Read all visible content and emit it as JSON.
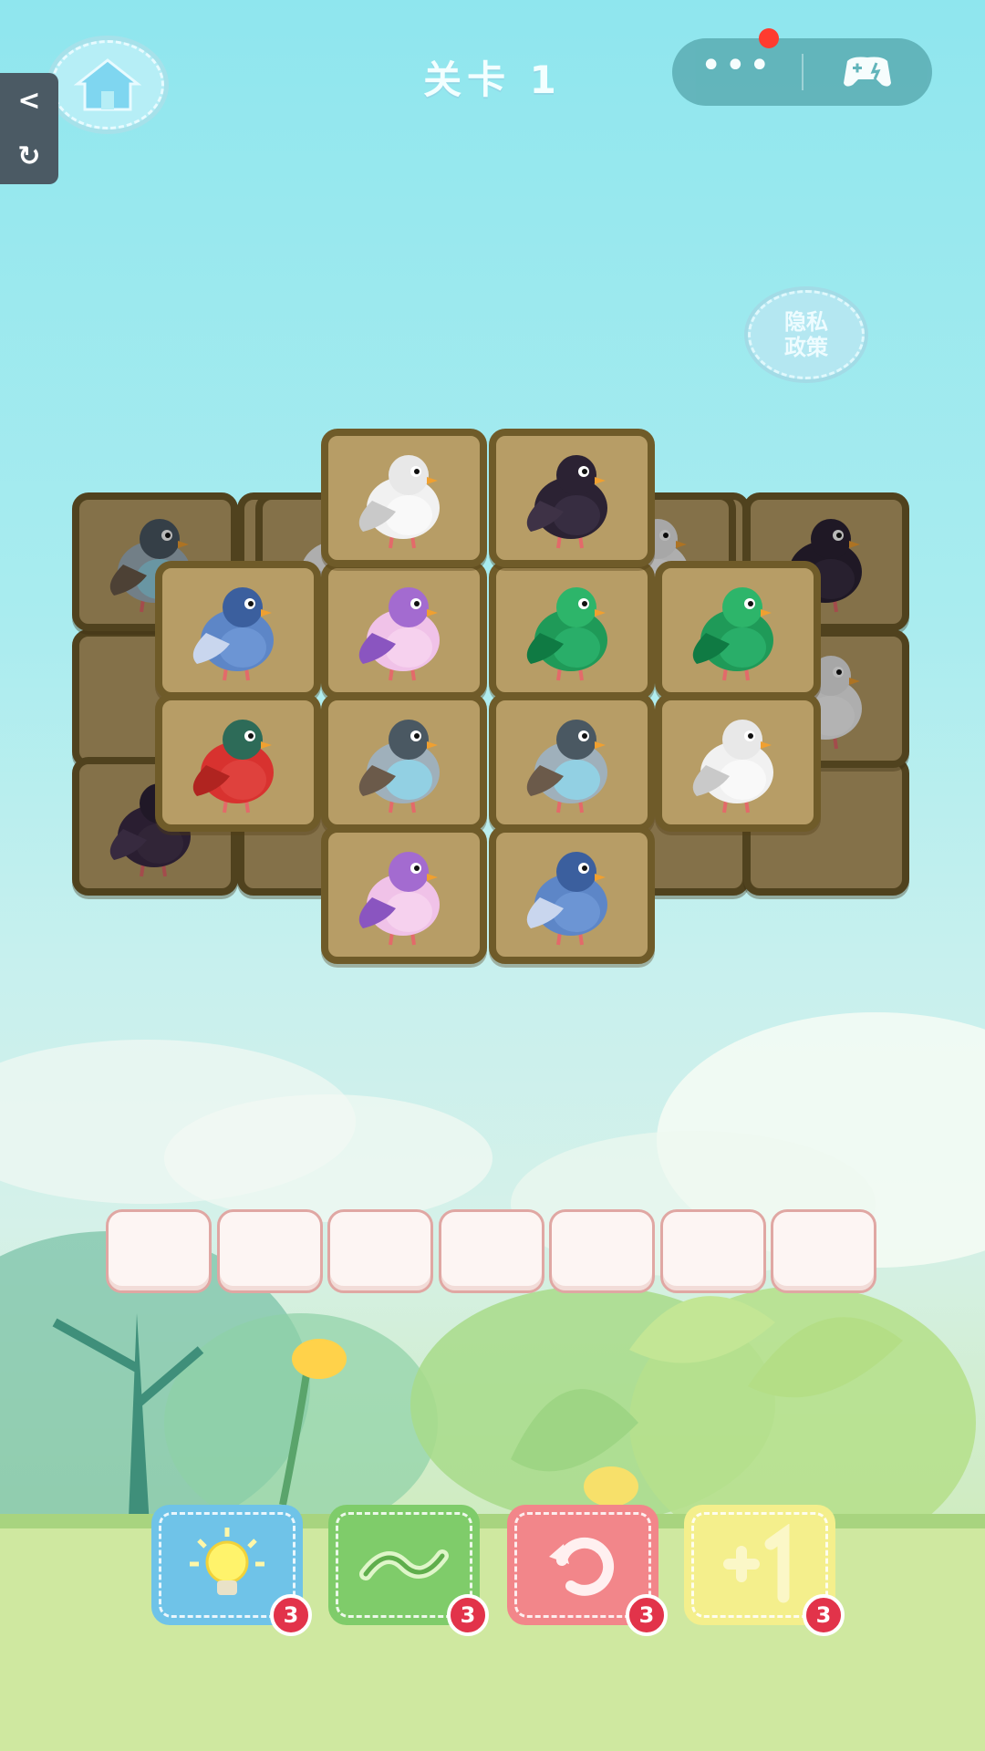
{
  "header": {
    "level_title": "关卡 1",
    "menu_dots": "•••",
    "privacy_label": "隐私\n政策",
    "back_symbol": "<",
    "refresh_symbol": "↻"
  },
  "board": {
    "tiles": [
      {
        "bird": "slate"
      },
      {
        "bird": "dark"
      },
      {
        "bird": "white"
      },
      {
        "bird": "white"
      },
      {
        "bird": "dark-purple"
      },
      {
        "bird": "white"
      },
      {
        "bird": "blue"
      },
      {
        "bird": "purple"
      },
      {
        "bird": "green"
      },
      {
        "bird": "green"
      },
      {
        "bird": "red"
      },
      {
        "bird": "slate"
      },
      {
        "bird": "slate"
      },
      {
        "bird": "white"
      },
      {
        "bird": "purple"
      },
      {
        "bird": "blue"
      }
    ]
  },
  "tray": {
    "slot_count": 7
  },
  "powerups": [
    {
      "name": "hint",
      "count": "3",
      "color": "#6fc3e8"
    },
    {
      "name": "shuffle",
      "count": "3",
      "color": "#7fcc6a"
    },
    {
      "name": "undo",
      "count": "3",
      "color": "#f2868a"
    },
    {
      "name": "add-slot",
      "count": "3",
      "color": "#f4ef8c"
    }
  ],
  "colors": {
    "tile_fill": "#b79d66",
    "tile_border": "#6f5b29",
    "badge": "#e2334a"
  }
}
